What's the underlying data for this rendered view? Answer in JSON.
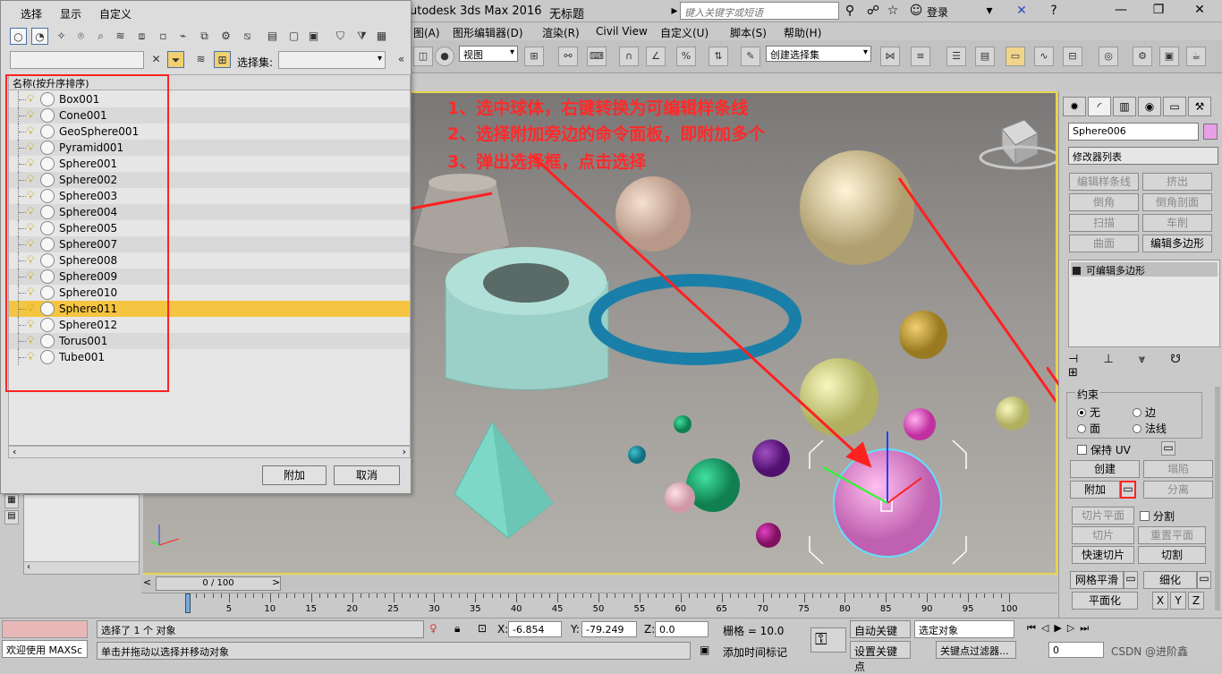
{
  "app": {
    "title": "utodesk 3ds Max 2016",
    "document": "无标题",
    "search_placeholder": "键入关键字或短语",
    "login": "登录"
  },
  "main_menu": [
    "图(A)",
    "图形编辑器(D)",
    "渲染(R)",
    "Civil View",
    "自定义(U)",
    "脚本(S)",
    "帮助(H)"
  ],
  "main_toolbar": {
    "view_dropdown": "视图",
    "selection_set": "创建选择集"
  },
  "dialog": {
    "menu": [
      "选择",
      "显示",
      "自定义"
    ],
    "selection_set_label": "选择集:",
    "column_header": "名称(按升序排序)",
    "objects": [
      "Box001",
      "Cone001",
      "GeoSphere001",
      "Pyramid001",
      "Sphere001",
      "Sphere002",
      "Sphere003",
      "Sphere004",
      "Sphere005",
      "Sphere007",
      "Sphere008",
      "Sphere009",
      "Sphere010",
      "Sphere011",
      "Sphere012",
      "Torus001",
      "Tube001"
    ],
    "selected_object": "Sphere011",
    "attach_button": "附加",
    "cancel_button": "取消"
  },
  "annotations": [
    "1、选中球体，右键转换为可编辑样条线",
    "2、选择附加旁边的命令面板，即附加多个",
    "3、弹出选择框，点击选择"
  ],
  "command_panel": {
    "object_name": "Sphere006",
    "modifier_list": "修改器列表",
    "buttons": [
      "编辑样条线",
      "挤出",
      "倒角",
      "倒角剖面",
      "扫描",
      "车削",
      "曲面",
      "编辑多边形"
    ],
    "stack_item": "可编辑多边形",
    "constraints_title": "约束",
    "constraints": [
      "无",
      "边",
      "面",
      "法线"
    ],
    "preserve_uv": "保持 UV",
    "create": "创建",
    "collapse": "塌陷",
    "attach": "附加",
    "detach": "分离",
    "slice_plane": "切片平面",
    "split": "分割",
    "slice": "切片",
    "reset_plane": "重置平面",
    "quickslice": "快速切片",
    "cut": "切割",
    "meshsmooth": "网格平滑",
    "tessellate": "细化",
    "make_planar": "平面化",
    "xyz": [
      "X",
      "Y",
      "Z"
    ]
  },
  "timeline": {
    "frame_display": "0 / 100",
    "ticks": [
      0,
      5,
      10,
      15,
      20,
      25,
      30,
      35,
      40,
      45,
      50,
      55,
      60,
      65,
      70,
      75,
      80,
      85,
      90,
      95,
      100
    ]
  },
  "status": {
    "welcome": "欢迎使用 MAXSc",
    "selected": "选择了 1 个 对象",
    "prompt": "单击并拖动以选择并移动对象",
    "x_label": "X:",
    "x": "-6.854",
    "y_label": "Y:",
    "y": "-79.249",
    "z_label": "Z:",
    "z": "0.0",
    "grid": "栅格 = 10.0",
    "add_time_tag": "添加时间标记",
    "auto_key": "自动关键点",
    "set_key": "设置关键点",
    "selected_object_dropdown": "选定对象",
    "key_filters": "关键点过滤器...",
    "frame": "0",
    "watermark": "CSDN @进阶鑫"
  },
  "colors": {
    "viewport_border": "#e8d44a",
    "annotation": "#ff2a2a",
    "selected_row": "#f5c542",
    "object_color_swatch": "#e8a0e8"
  }
}
